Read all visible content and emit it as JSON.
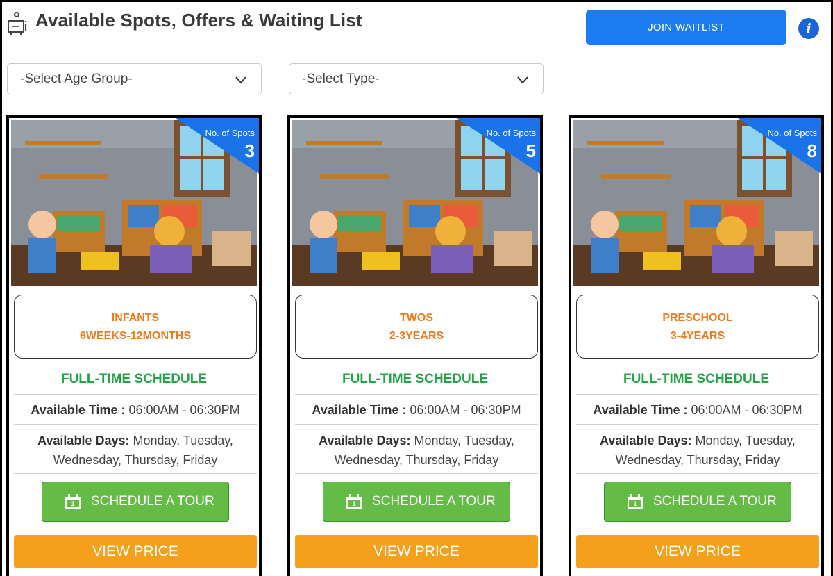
{
  "header": {
    "title": "Available Spots, Offers & Waiting List",
    "join_label": "JOIN WAITLIST",
    "info_glyph": "i"
  },
  "filters": {
    "age_group": "-Select Age Group-",
    "type": "-Select Type-"
  },
  "colors": {
    "primary_blue": "#1a7cf0",
    "accent_orange": "#ee7a1e",
    "schedule_green": "#22a447",
    "tour_green": "#64bb45",
    "price_orange": "#f5a01a"
  },
  "cards": [
    {
      "spots_label": "No. of Spots",
      "spots_count": "3",
      "age_name": "INFANTS",
      "age_range": "6WEEKS-12MONTHS",
      "schedule": "FULL-TIME SCHEDULE",
      "time_label": "Available Time :",
      "time_value": " 06:00AM - 06:30PM",
      "days_label": "Available Days:",
      "days_value": " Monday, Tuesday, Wednesday, Thursday, Friday",
      "tour_label": "SCHEDULE A TOUR",
      "price_label": "VIEW PRICE"
    },
    {
      "spots_label": "No. of Spots",
      "spots_count": "5",
      "age_name": "TWOS",
      "age_range": "2-3YEARS",
      "schedule": "FULL-TIME SCHEDULE",
      "time_label": "Available Time :",
      "time_value": " 06:00AM - 06:30PM",
      "days_label": "Available Days:",
      "days_value": " Monday, Tuesday, Wednesday, Thursday, Friday",
      "tour_label": "SCHEDULE A TOUR",
      "price_label": "VIEW PRICE"
    },
    {
      "spots_label": "No. of Spots",
      "spots_count": "8",
      "age_name": "PRESCHOOL",
      "age_range": "3-4YEARS",
      "schedule": "FULL-TIME SCHEDULE",
      "time_label": "Available Time :",
      "time_value": " 06:00AM - 06:30PM",
      "days_label": "Available Days:",
      "days_value": " Monday, Tuesday, Wednesday, Thursday, Friday",
      "tour_label": "SCHEDULE A TOUR",
      "price_label": "VIEW PRICE"
    }
  ]
}
